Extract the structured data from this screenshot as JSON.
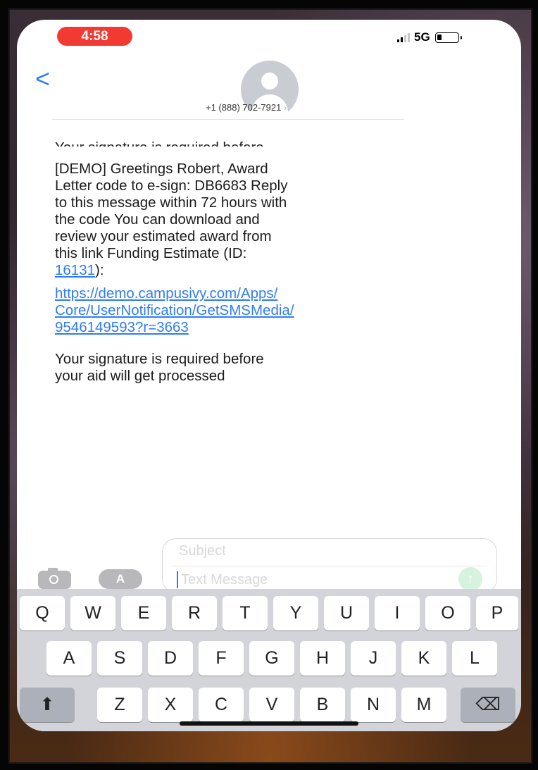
{
  "status_bar": {
    "time": "4:58",
    "network": "5G"
  },
  "header": {
    "back_glyph": "<",
    "contact": "+1 (888) 702-7921",
    "chevron": "›"
  },
  "messages": {
    "clipped": "Your signature is required before\nyour aid will get processed",
    "main_text": "[DEMO] Greetings Robert, Award\nLetter code to e-sign: DB6683 Reply\nto this message within 72 hours with\nthe code You can download and\nreview your estimated award from\nthis link  Funding Estimate (ID:\n",
    "id_link": "16131",
    "id_suffix": "):",
    "url": "https://demo.campusivy.com/Apps/\nCore/UserNotification/GetSMSMedia/\n9546149593?r=3663",
    "tail": " Your signature is required before\nyour aid will get processed"
  },
  "compose": {
    "subject_placeholder": "Subject",
    "message_placeholder": "Text Message",
    "send_glyph": "↑",
    "appstore_glyph": "A"
  },
  "keyboard": {
    "row1": [
      "Q",
      "W",
      "E",
      "R",
      "T",
      "Y",
      "U",
      "I",
      "O",
      "P"
    ],
    "row2": [
      "A",
      "S",
      "D",
      "F",
      "G",
      "H",
      "J",
      "K",
      "L"
    ],
    "row3": [
      "Z",
      "X",
      "C",
      "V",
      "B",
      "N",
      "M"
    ],
    "shift_glyph": "⬆",
    "delete_glyph": "⌫"
  },
  "colors": {
    "accent": "#2f7cf6",
    "time_pill": "#f23a33"
  },
  "icons": [
    "back-chevron-icon",
    "avatar-icon",
    "camera-icon",
    "app-store-icon",
    "send-icon",
    "shift-icon",
    "delete-icon",
    "signal-icon",
    "battery-icon"
  ]
}
